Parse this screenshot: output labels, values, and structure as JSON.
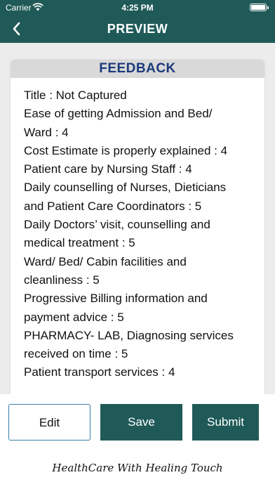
{
  "status_bar": {
    "carrier": "Carrier",
    "time": "4:25 PM"
  },
  "nav": {
    "title": "PREVIEW",
    "back_icon": "chevron-left-icon"
  },
  "card": {
    "header": "FEEDBACK",
    "lines": [
      "Title : Not Captured",
      "Ease of getting Admission and Bed/",
      "Ward : 4",
      "Cost Estimate is properly explained : 4",
      "Patient care by Nursing Staff : 4",
      "Daily counselling of Nurses, Dieticians",
      "and Patient Care Coordinators : 5",
      "Daily Doctors’ visit, counselling and",
      "medical treatment : 5",
      "Ward/ Bed/ Cabin facilities and",
      "cleanliness : 5",
      "Progressive Billing information and",
      "payment advice : 5",
      "PHARMACY- LAB, Diagnosing services",
      "received on time : 5",
      "Patient transport services : 4"
    ]
  },
  "actions": {
    "edit_label": "Edit",
    "save_label": "Save",
    "submit_label": "Submit"
  },
  "footer": {
    "tagline": "HealthCare With Healing Touch"
  },
  "colors": {
    "primary": "#1f5a58",
    "header_text": "#1a3a7a",
    "background": "#ececec"
  }
}
